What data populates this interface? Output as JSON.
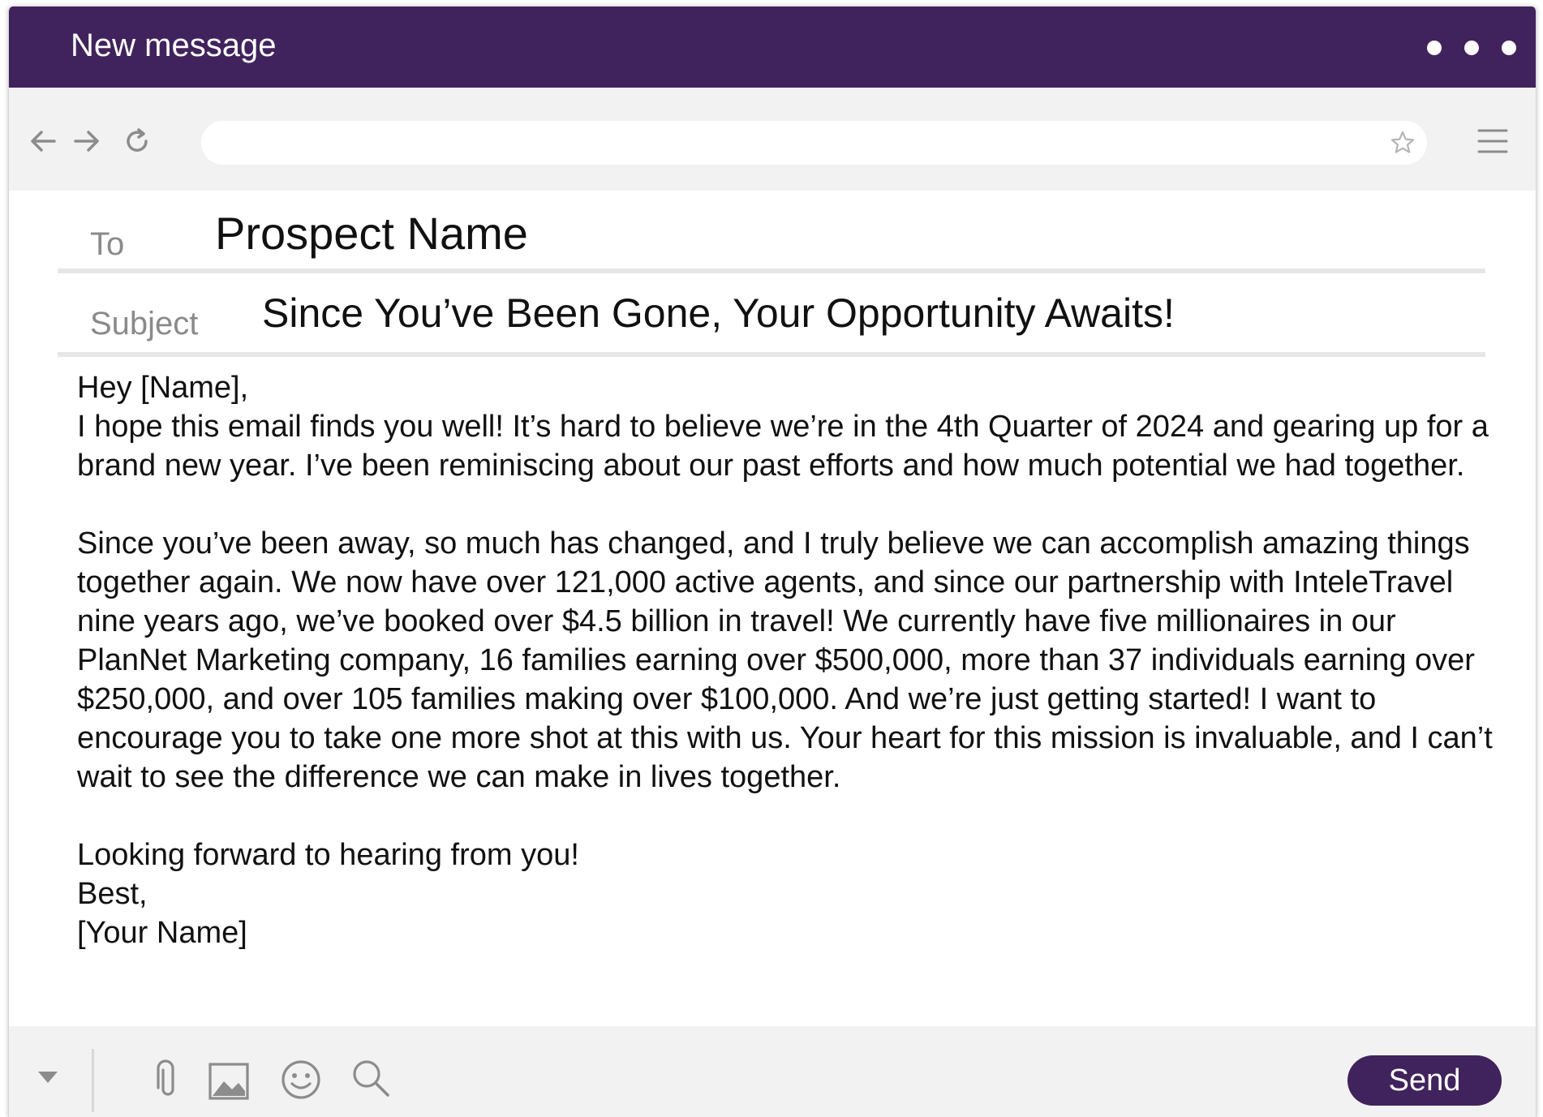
{
  "window": {
    "title": "New message"
  },
  "navbar": {
    "address_value": "",
    "icons": [
      "back-arrow-icon",
      "forward-arrow-icon",
      "reload-icon",
      "star-icon",
      "hamburger-menu-icon"
    ]
  },
  "header": {
    "to_label": "To",
    "to_value": "Prospect Name",
    "subject_label": "Subject",
    "subject_value": "Since You’ve Been Gone, Your Opportunity Awaits!"
  },
  "message": {
    "greeting": "Hey [Name],",
    "paragraph1": "I hope this email finds you well! It’s hard to believe we’re in the 4th Quarter of 2024 and gearing up for a brand new year. I’ve been reminiscing about our past efforts and how much potential we had together.",
    "paragraph2": "Since you’ve been away, so much has changed, and I truly believe we can accomplish amazing things together again. We now have over 121,000 active agents, and since our partnership with InteleTravel nine years ago, we’ve booked over $4.5 billion in travel! We currently have five millionaires in our PlanNet Marketing company, 16 families earning over $500,000, more than 37 individuals earning over $250,000, and over 105 families making over $100,000. And we’re just getting started! I want to encourage you to take one more shot at this with us. Your heart for this mission is invaluable, and I can’t wait to see the difference we can make in lives together.",
    "closing": "Looking forward to hearing from you!",
    "signoff": "Best,",
    "signature": "[Your Name]"
  },
  "toolbar": {
    "send_label": "Send",
    "icons": [
      "dropdown-caret-icon",
      "paperclip-icon",
      "image-icon",
      "emoji-icon",
      "search-icon"
    ]
  },
  "colors": {
    "brand": "#40235c",
    "toolbar_bg": "#f2f2f2",
    "label_gray": "#8a8a8a"
  }
}
